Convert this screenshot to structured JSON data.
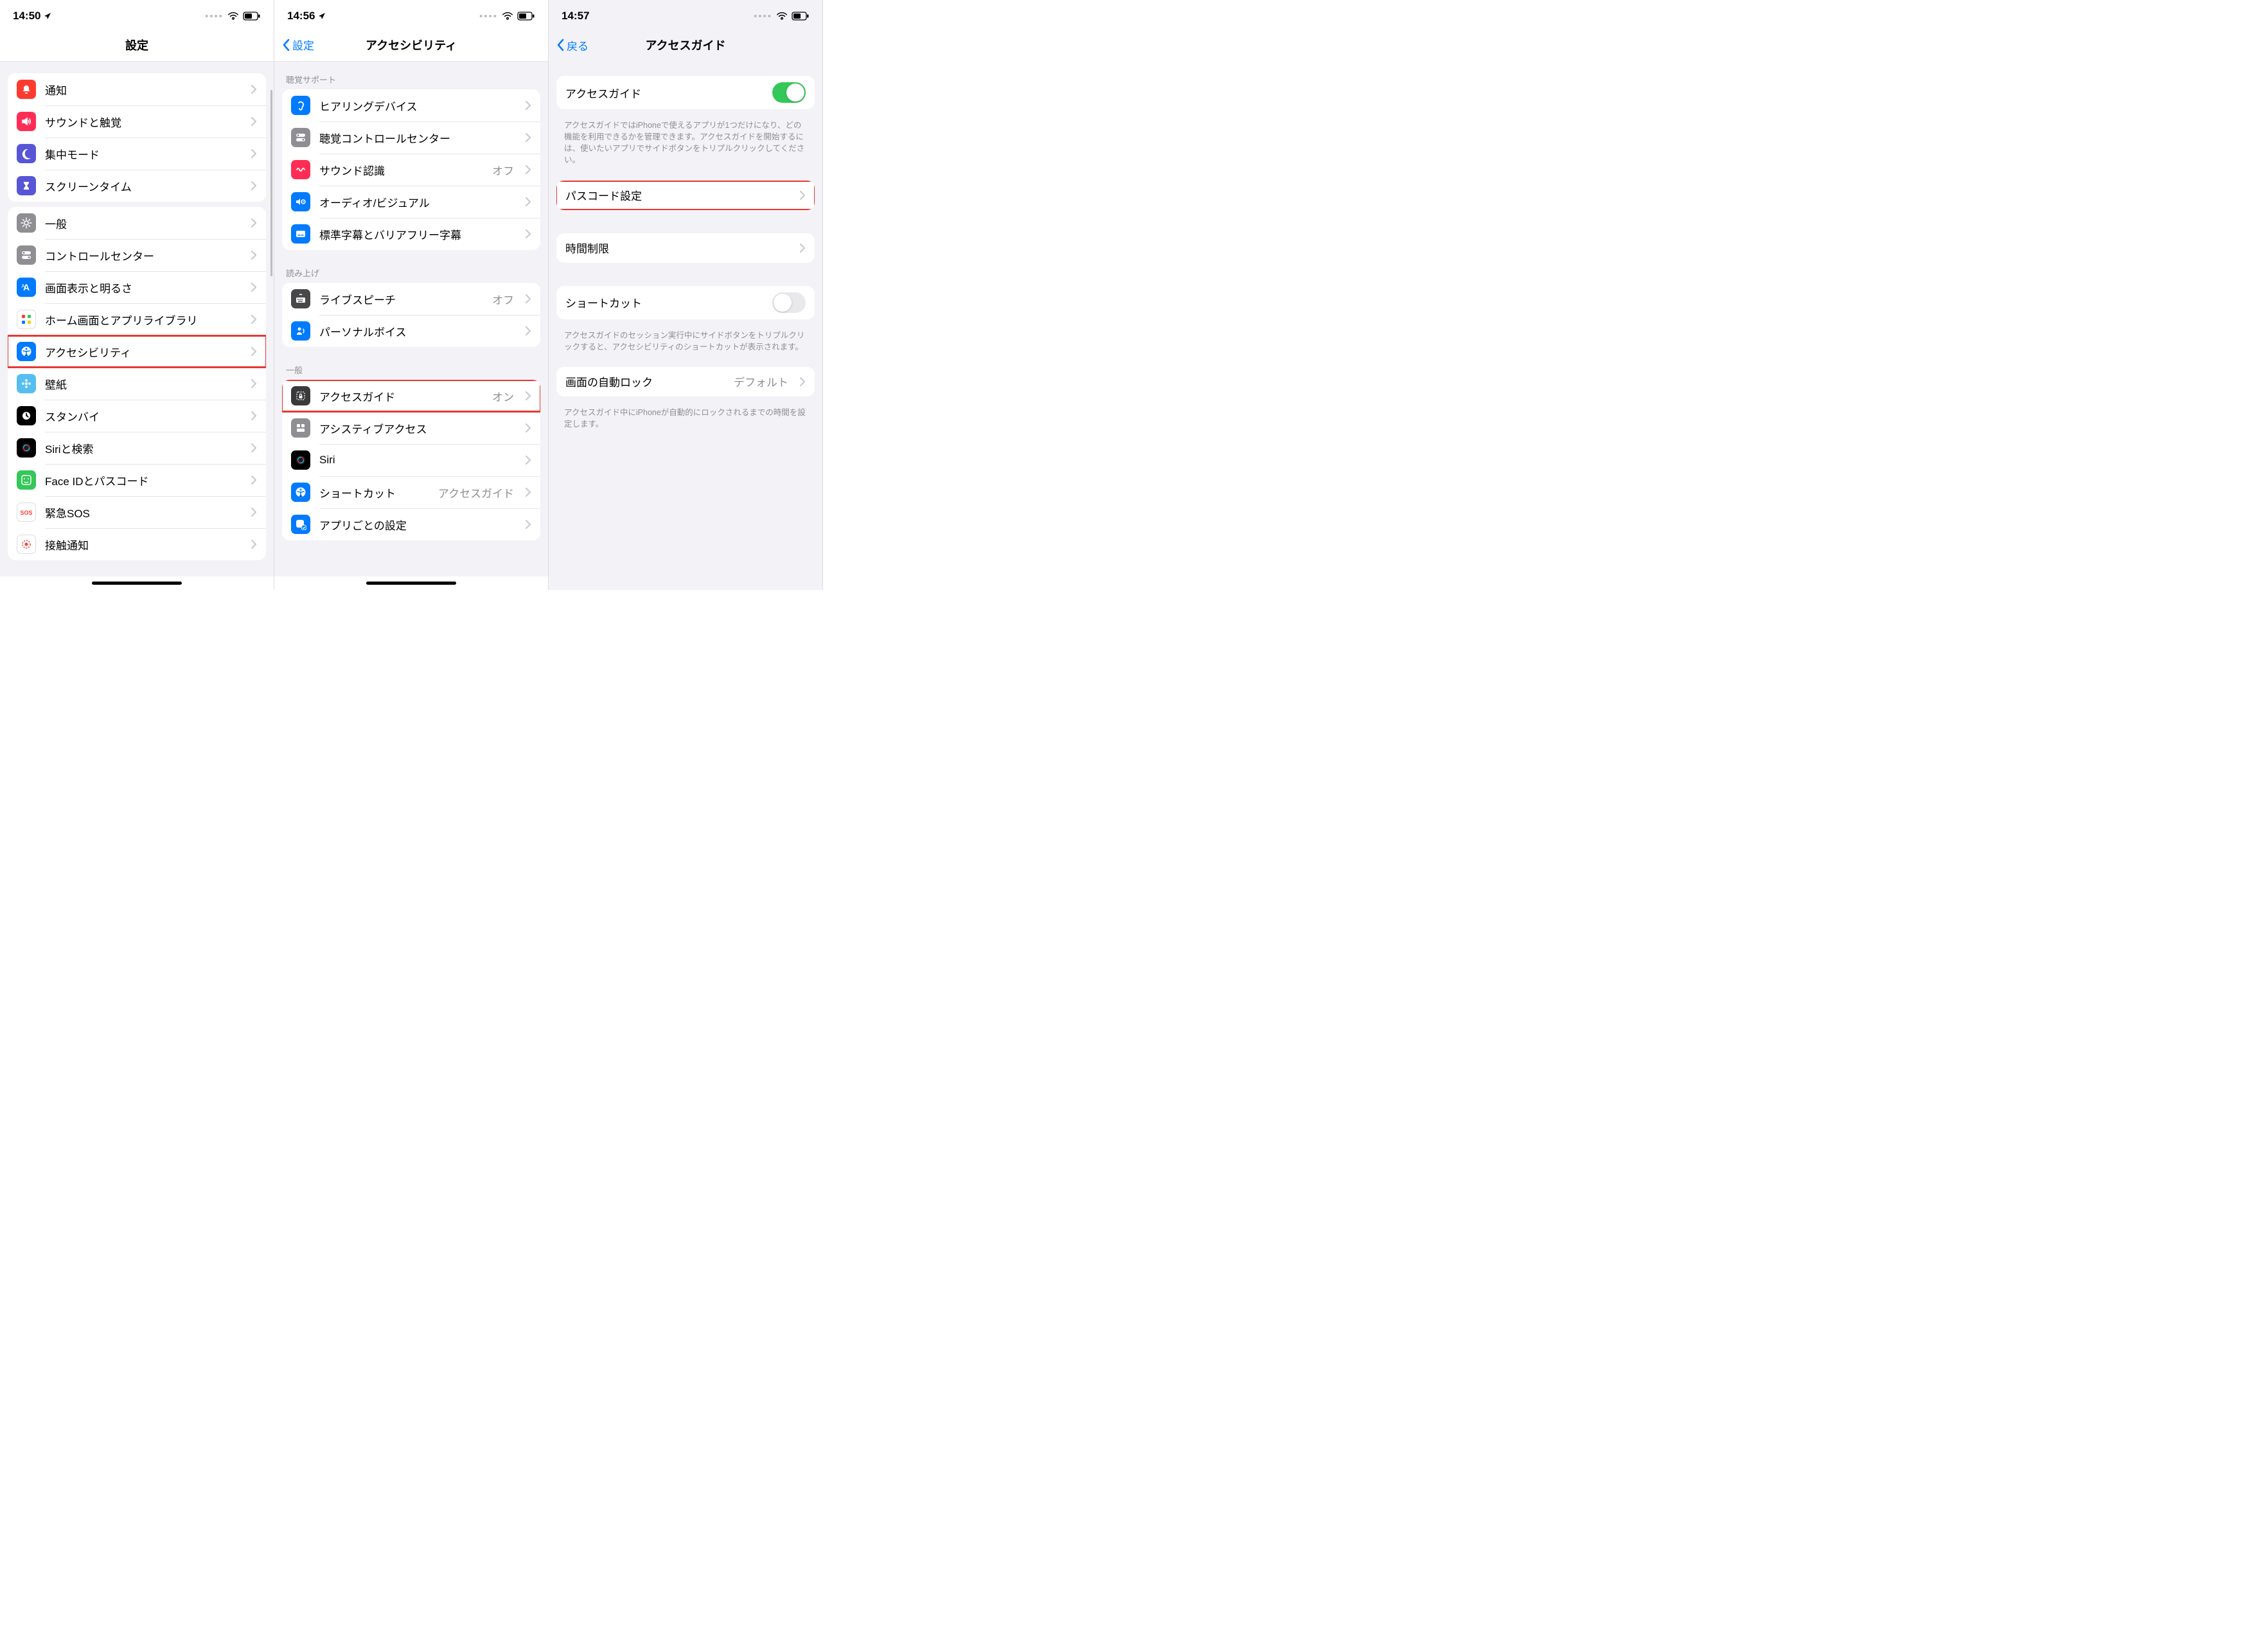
{
  "screen1": {
    "time": "14:50",
    "title": "設定",
    "groups": [
      {
        "section": null,
        "rows": [
          {
            "icon": "bell",
            "bg": "#ff3b30",
            "label": "通知"
          },
          {
            "icon": "speaker",
            "bg": "#ff2d55",
            "label": "サウンドと触覚"
          },
          {
            "icon": "moon",
            "bg": "#5856d6",
            "label": "集中モード"
          },
          {
            "icon": "hourglass",
            "bg": "#5856d6",
            "label": "スクリーンタイム"
          }
        ]
      },
      {
        "section": null,
        "rows": [
          {
            "icon": "gear",
            "bg": "#8e8e93",
            "label": "一般"
          },
          {
            "icon": "switches",
            "bg": "#8e8e93",
            "label": "コントロールセンター"
          },
          {
            "icon": "brightness",
            "bg": "#007aff",
            "label": "画面表示と明るさ"
          },
          {
            "icon": "grid",
            "bg": "grid",
            "label": "ホーム画面とアプリライブラリ"
          },
          {
            "icon": "accessibility",
            "bg": "#007aff",
            "label": "アクセシビリティ",
            "highlight": true
          },
          {
            "icon": "flower",
            "bg": "#55bef0",
            "label": "壁紙"
          },
          {
            "icon": "clock",
            "bg": "#000",
            "label": "スタンバイ"
          },
          {
            "icon": "siri",
            "bg": "#000",
            "label": "Siriと検索"
          },
          {
            "icon": "faceid",
            "bg": "#34c759",
            "label": "Face IDとパスコード"
          },
          {
            "icon": "sos",
            "bg": "#fff",
            "fg": "#ff3b30",
            "label": "緊急SOS"
          },
          {
            "icon": "exposure",
            "bg": "#fff",
            "label": "接触通知"
          }
        ]
      }
    ]
  },
  "screen2": {
    "time": "14:56",
    "back": "設定",
    "title": "アクセシビリティ",
    "sections": [
      {
        "header": "聴覚サポート",
        "rows": [
          {
            "icon": "ear",
            "bg": "#007aff",
            "label": "ヒアリングデバイス"
          },
          {
            "icon": "switches",
            "bg": "#8e8e93",
            "label": "聴覚コントロールセンター"
          },
          {
            "icon": "wave",
            "bg": "#ff2d55",
            "label": "サウンド認識",
            "value": "オフ"
          },
          {
            "icon": "audiovideo",
            "bg": "#007aff",
            "label": "オーディオ/ビジュアル"
          },
          {
            "icon": "cc",
            "bg": "#007aff",
            "label": "標準字幕とバリアフリー字幕"
          }
        ]
      },
      {
        "header": "読み上げ",
        "rows": [
          {
            "icon": "keyboard",
            "bg": "#48484a",
            "label": "ライブスピーチ",
            "value": "オフ"
          },
          {
            "icon": "personvoice",
            "bg": "#007aff",
            "label": "パーソナルボイス"
          }
        ]
      },
      {
        "header": "一般",
        "rows": [
          {
            "icon": "lock-dashed",
            "bg": "#3a3a3c",
            "label": "アクセスガイド",
            "value": "オン",
            "highlight": true
          },
          {
            "icon": "widgets",
            "bg": "#8e8e93",
            "label": "アシスティブアクセス"
          },
          {
            "icon": "siri",
            "bg": "#000",
            "label": "Siri"
          },
          {
            "icon": "accessibility",
            "bg": "#007aff",
            "label": "ショートカット",
            "value": "アクセスガイド"
          },
          {
            "icon": "app-check",
            "bg": "#007aff",
            "label": "アプリごとの設定"
          }
        ]
      }
    ]
  },
  "screen3": {
    "time": "14:57",
    "back": "戻る",
    "title": "アクセスガイド",
    "rows1": [
      {
        "label": "アクセスガイド",
        "toggle": true,
        "on": true
      }
    ],
    "note1": "アクセスガイドではiPhoneで使えるアプリが1つだけになり、どの機能を利用できるかを管理できます。アクセスガイドを開始するには、使いたいアプリでサイドボタンをトリプルクリックしてください。",
    "rows2": [
      {
        "label": "パスコード設定",
        "highlight": true
      }
    ],
    "rows3": [
      {
        "label": "時間制限"
      }
    ],
    "rows4": [
      {
        "label": "ショートカット",
        "toggle": true,
        "on": false
      }
    ],
    "note4": "アクセスガイドのセッション実行中にサイドボタンをトリプルクリックすると、アクセシビリティのショートカットが表示されます。",
    "rows5": [
      {
        "label": "画面の自動ロック",
        "value": "デフォルト"
      }
    ],
    "note5": "アクセスガイド中にiPhoneが自動的にロックされるまでの時間を設定します。"
  }
}
